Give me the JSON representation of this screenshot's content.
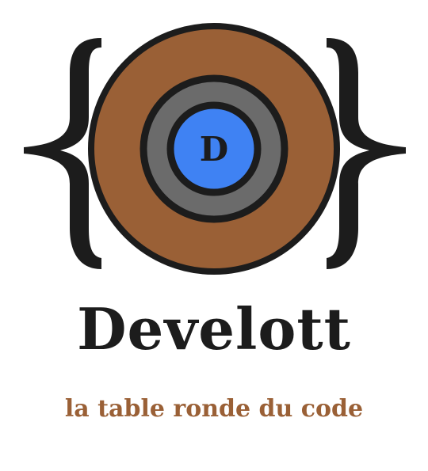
{
  "brand": {
    "name": "Develott",
    "tagline": "la table ronde du code",
    "emblem_letter": "D"
  },
  "colors": {
    "background": "#ffffff",
    "ink": "#1c1c1c",
    "wood": "#9a6036",
    "steel": "#6b6b6b",
    "core": "#3f82f3"
  },
  "icons": {
    "left_brace": "curly-brace-open-icon",
    "right_brace": "curly-brace-close-icon",
    "shield": "round-shield-icon"
  }
}
